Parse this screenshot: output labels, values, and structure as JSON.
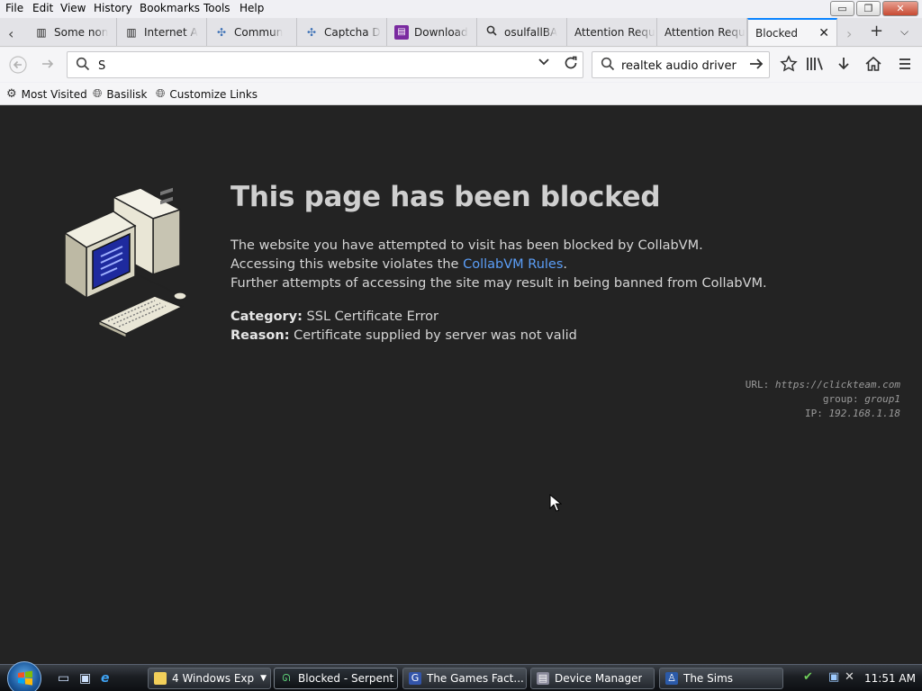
{
  "menu": {
    "file": "File",
    "edit": "Edit",
    "view": "View",
    "history": "History",
    "bookmarks": "Bookmarks",
    "tools": "Tools",
    "help": "Help"
  },
  "window_buttons": {
    "minimize": "▭",
    "restore": "❐",
    "close": "✕"
  },
  "tabs": [
    {
      "label": "Some non",
      "icon": "library-icon"
    },
    {
      "label": "Internet A",
      "icon": "library-icon"
    },
    {
      "label": "Commun",
      "icon": "puzzle-icon"
    },
    {
      "label": "Captcha D",
      "icon": "puzzle-icon"
    },
    {
      "label": "Download",
      "icon": "download-site-icon"
    },
    {
      "label": "osulfallBA",
      "icon": "search-icon"
    },
    {
      "label": "Attention Requ",
      "icon": ""
    },
    {
      "label": "Attention Requ",
      "icon": ""
    },
    {
      "label": "Blocked",
      "icon": "",
      "active": true
    }
  ],
  "urlbar": {
    "value": "S"
  },
  "searchbar": {
    "value": "realtek audio driver"
  },
  "bookmarks_bar": [
    {
      "label": "Most Visited",
      "icon": "gear-icon"
    },
    {
      "label": "Basilisk",
      "icon": "globe-icon"
    },
    {
      "label": "Customize Links",
      "icon": "globe-icon"
    }
  ],
  "page": {
    "title": "This page has been blocked",
    "line1": "The website you have attempted to visit has been blocked by CollabVM.",
    "line2_pre": "Accessing this website violates the ",
    "line2_link": "CollabVM Rules",
    "line2_post": ".",
    "line3": "Further attempts of accessing the site may result in being banned from CollabVM.",
    "category_label": "Category:",
    "category_value": " SSL Certificate Error",
    "reason_label": "Reason:",
    "reason_value": " Certificate supplied by server was not valid",
    "meta_url_label": "URL: ",
    "meta_url_value": "https://clickteam.com",
    "meta_group_label": "group: ",
    "meta_group_value": "group1",
    "meta_ip_label": "IP: ",
    "meta_ip_value": "192.168.1.18"
  },
  "taskbar": {
    "tasks": [
      {
        "label": "4 Windows Exp...",
        "icon": "folder-icon"
      },
      {
        "label": "Blocked - Serpent",
        "icon": "serpent-icon",
        "active": true
      },
      {
        "label": "The Games Fact...",
        "icon": "games-factory-icon"
      },
      {
        "label": "Device Manager",
        "icon": "device-manager-icon"
      },
      {
        "label": "The Sims",
        "icon": "sims-icon"
      }
    ],
    "clock": "11:51 AM"
  },
  "colors": {
    "link": "#5b9ef7",
    "page_bg": "#232323",
    "accent_tab": "#0a84ff"
  }
}
